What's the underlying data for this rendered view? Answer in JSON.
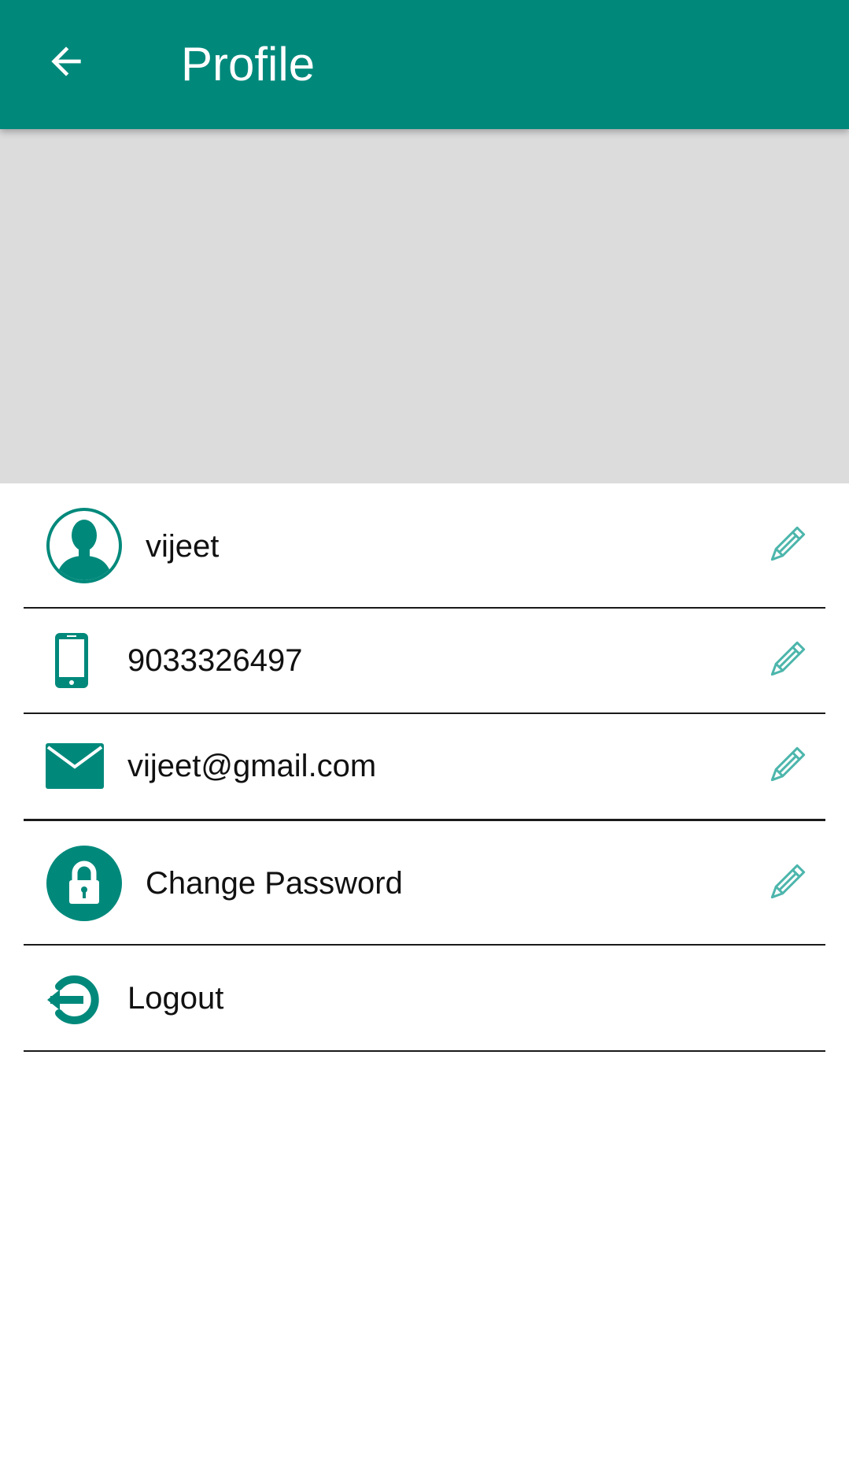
{
  "header": {
    "title": "Profile",
    "back_icon": "arrow-left-icon",
    "color": "#00897B"
  },
  "banner": {
    "color": "#DCDCDC"
  },
  "profile": {
    "name": "vijeet",
    "phone": "9033326497",
    "email": "vijeet@gmail.com",
    "change_password_label": "Change Password",
    "logout_label": "Logout"
  },
  "icons": {
    "name": "user-avatar-icon",
    "phone": "smartphone-icon",
    "email": "envelope-icon",
    "password": "lock-icon",
    "logout": "logout-icon",
    "edit": "pencil-icon"
  },
  "colors": {
    "accent": "#00897B",
    "edit_icon": "#4DB6AC",
    "divider": "#1A1A1A"
  }
}
